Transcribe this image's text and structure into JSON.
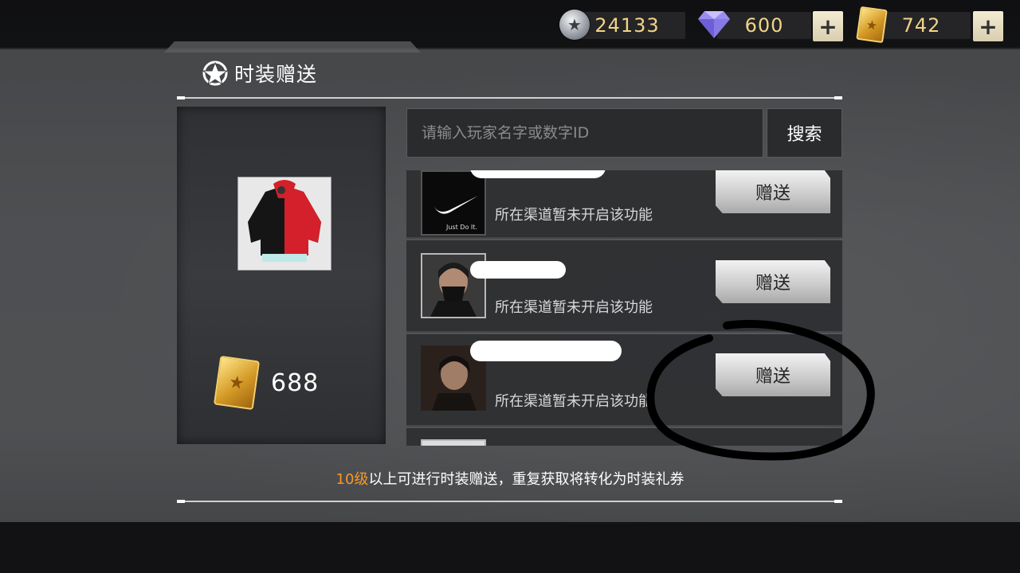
{
  "currencies": {
    "silver": {
      "value": "24133"
    },
    "diamond": {
      "value": "600"
    },
    "voucher": {
      "value": "742"
    },
    "plus_label": "+"
  },
  "panel": {
    "title": "时装赠送"
  },
  "item": {
    "price": "688"
  },
  "search": {
    "placeholder": "请输入玩家名字或数字ID",
    "button_label": "搜索"
  },
  "players": [
    {
      "status": "所在渠道暂未开启该功能",
      "button": "赠送",
      "avatar": "Just Do It."
    },
    {
      "status": "所在渠道暂未开启该功能",
      "button": "赠送"
    },
    {
      "status": "所在渠道暂未开启该功能",
      "button": "赠送"
    }
  ],
  "footer": {
    "highlight": "10级",
    "text": "以上可进行时装赠送，重复获取将转化为时装礼券"
  },
  "colors": {
    "accent_orange": "#f39a2b",
    "gold_text": "#f1d487"
  }
}
